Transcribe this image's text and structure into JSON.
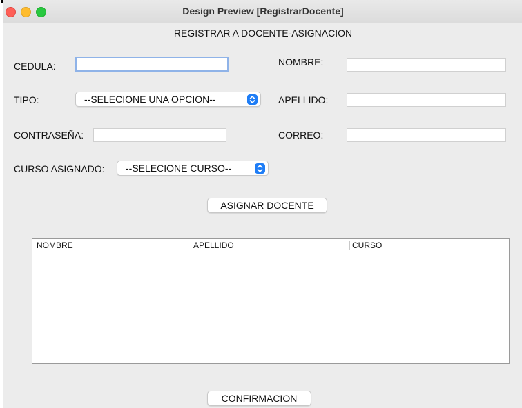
{
  "window": {
    "title": "Design Preview [RegistrarDocente]"
  },
  "form": {
    "heading": "REGISTRAR A DOCENTE-ASIGNACION",
    "cedula_label": "CEDULA:",
    "cedula_value": "",
    "nombre_label": "NOMBRE:",
    "nombre_value": "",
    "tipo_label": "TIPO:",
    "tipo_selected": "--SELECIONE UNA OPCION--",
    "apellido_label": "APELLIDO:",
    "apellido_value": "",
    "contrasena_label": "CONTRASEÑA:",
    "contrasena_value": "",
    "correo_label": "CORREO:",
    "correo_value": "",
    "curso_label": "CURSO ASIGNADO:",
    "curso_selected": "--SELECIONE CURSO--",
    "assign_button": "ASIGNAR DOCENTE",
    "confirm_button": "CONFIRMACION"
  },
  "table": {
    "columns": [
      "NOMBRE",
      "APELLIDO",
      "CURSO"
    ],
    "rows": []
  },
  "colors": {
    "select_accent": "#1e7df6",
    "focus_ring": "#8fb3e8",
    "window_bg": "#ececec"
  },
  "icons": {
    "select_arrow": "up-down-chevron-icon"
  }
}
